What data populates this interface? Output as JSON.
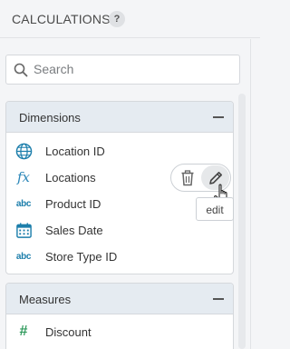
{
  "header": {
    "title": "CALCULATIONS",
    "help_icon": "?"
  },
  "search": {
    "placeholder": "Search"
  },
  "dimensions": {
    "title": "Dimensions",
    "items": [
      {
        "label": "Location ID",
        "icon": "globe-icon"
      },
      {
        "label": "Locations",
        "icon": "fx-icon",
        "icon_text": "fx"
      },
      {
        "label": "Product ID",
        "icon": "abc-icon",
        "icon_text": "abc"
      },
      {
        "label": "Sales Date",
        "icon": "calendar-icon"
      },
      {
        "label": "Store Type ID",
        "icon": "abc-icon",
        "icon_text": "abc"
      }
    ]
  },
  "measures": {
    "title": "Measures",
    "items": [
      {
        "label": "Discount",
        "icon": "hash-icon",
        "icon_text": "#"
      }
    ]
  },
  "row_actions": {
    "tooltip": "edit"
  },
  "colors": {
    "accent_blue": "#1c7eab",
    "measure_green": "#2f9a5c",
    "panel_header_bg": "#e5ebf1"
  }
}
